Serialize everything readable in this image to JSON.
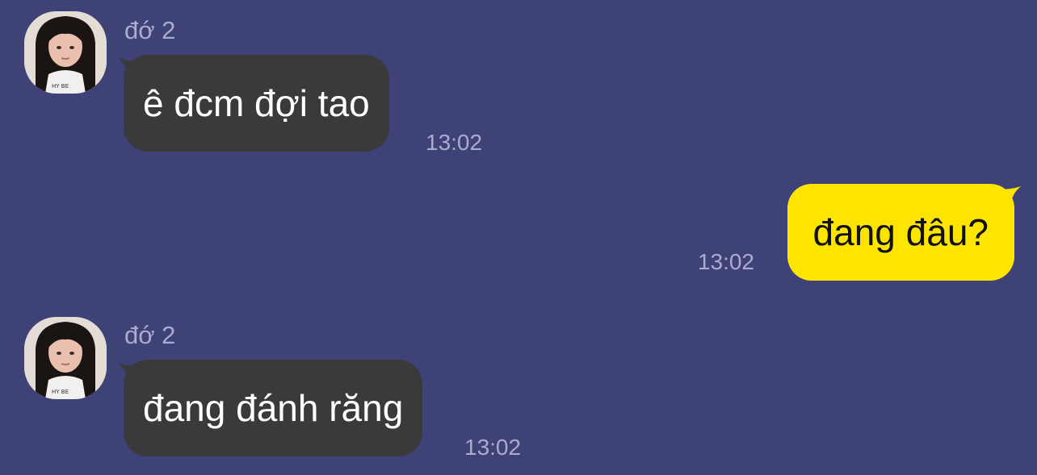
{
  "theme": {
    "background": "#3f4276",
    "incoming_bubble": "#3a3a3c",
    "outgoing_bubble": "#fee500",
    "meta_text": "#a9abcf"
  },
  "messages": [
    {
      "direction": "incoming",
      "sender": "đớ 2",
      "avatar": "profile-photo",
      "text": "ê đcm đợi tao",
      "time": "13:02"
    },
    {
      "direction": "outgoing",
      "text": "đang đâu?",
      "time": "13:02"
    },
    {
      "direction": "incoming",
      "sender": "đớ 2",
      "avatar": "profile-photo",
      "text": "đang đánh răng",
      "time": "13:02"
    }
  ]
}
